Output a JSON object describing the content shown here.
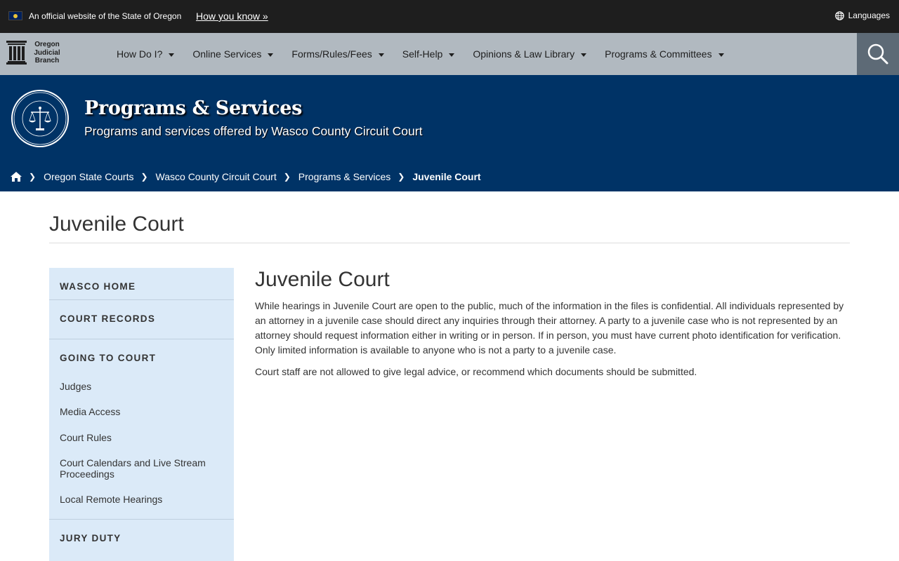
{
  "official_banner": {
    "text": "An official website of the State of Oregon",
    "how_you_know": "How you know »",
    "languages": "Languages"
  },
  "logo": {
    "line1": "Oregon",
    "line2": "Judicial",
    "line3": "Branch"
  },
  "nav": {
    "items": [
      {
        "label": "How Do I?"
      },
      {
        "label": "Online Services"
      },
      {
        "label": "Forms/Rules/Fees"
      },
      {
        "label": "Self-Help"
      },
      {
        "label": "Opinions & Law Library"
      },
      {
        "label": "Programs & Committees"
      }
    ]
  },
  "hero": {
    "title": "Programs & Services",
    "subtitle": "Programs and services offered by Wasco County Circuit Court"
  },
  "breadcrumb": {
    "items": [
      "Oregon State Courts",
      "Wasco County Circuit Court",
      "Programs & Services"
    ],
    "current": "Juvenile Court"
  },
  "page": {
    "title": "Juvenile Court"
  },
  "sidebar": {
    "wasco_home": "WASCO HOME",
    "court_records": "COURT RECORDS",
    "going_to_court": "GOING TO COURT",
    "going_items": [
      "Judges",
      "Media Access",
      "Court Rules",
      "Court Calendars and Live Stream Proceedings",
      "Local Remote Hearings"
    ],
    "jury_duty": "JURY DUTY"
  },
  "content": {
    "title": "Juvenile Court",
    "paragraph1": "While hearings in Juvenile Court are open to the public, much of the information in the files is confidential. All individuals represented by an attorney in a juvenile case should direct any inquiries through their attorney. A party to a juvenile case who is not represented by an attorney should request information either in writing or in person. If in person, you must have current photo identification for verification. Only limited information is available to anyone who is not a party to a juvenile case.",
    "paragraph2": "Court staff are not allowed to give legal advice, or recommend which documents should be submitted."
  },
  "colors": {
    "banner_bg": "#1e1e1e",
    "nav_bg": "#b1b9c0",
    "hero_bg": "#003366",
    "sidebar_bg": "#dbeaf8",
    "search_bg": "#5d6a76"
  }
}
